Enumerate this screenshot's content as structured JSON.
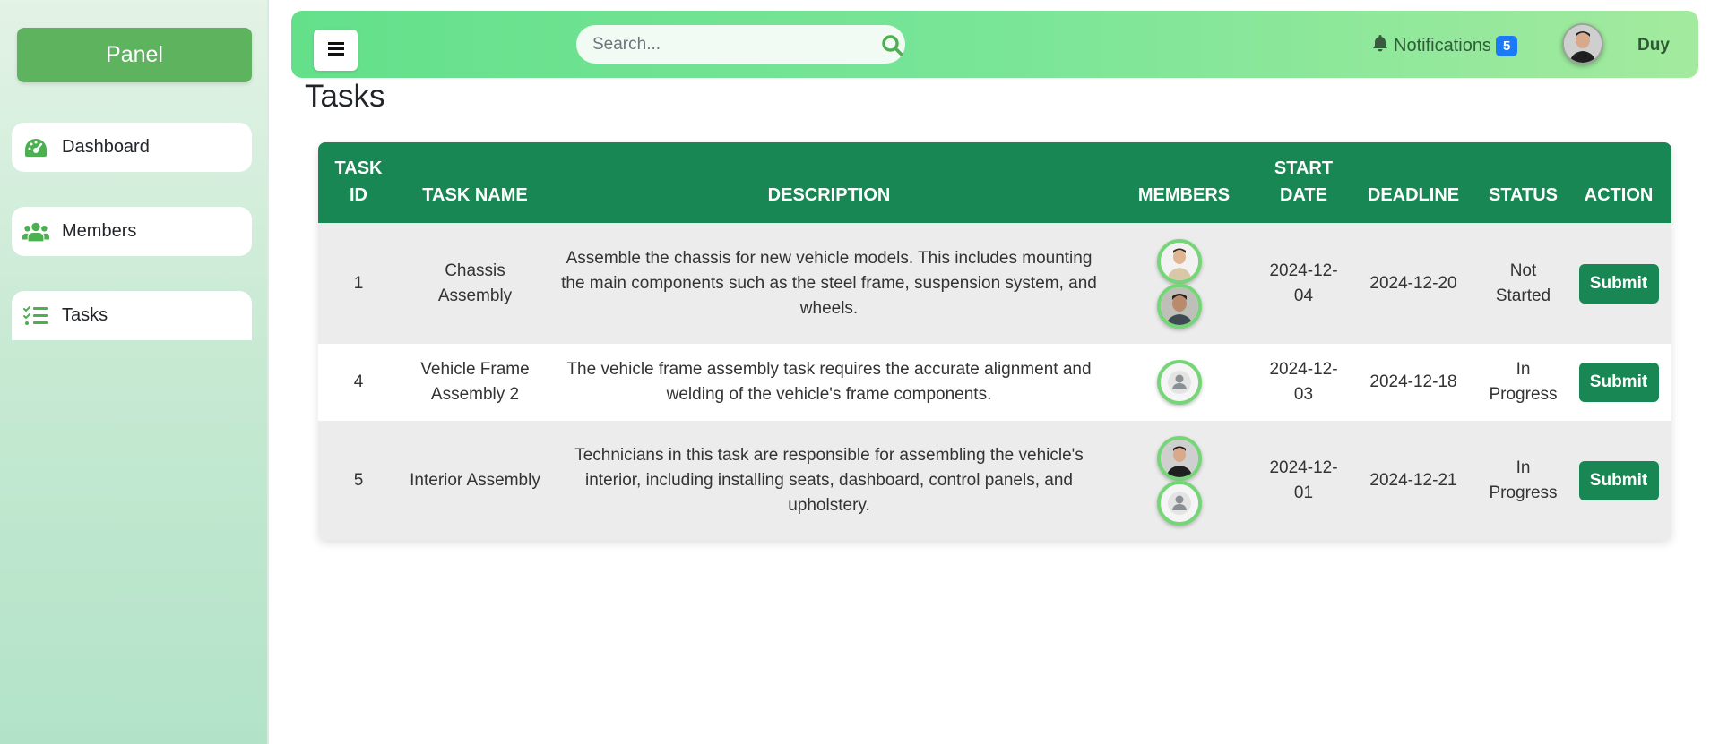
{
  "sidebar": {
    "panel_label": "Panel",
    "items": [
      {
        "label": "Dashboard",
        "icon": "gauge-icon"
      },
      {
        "label": "Members",
        "icon": "users-icon"
      },
      {
        "label": "Tasks",
        "icon": "list-check-icon"
      }
    ]
  },
  "header": {
    "search_placeholder": "Search...",
    "notifications_label": "Notifications",
    "notifications_count": "5",
    "username": "Duy"
  },
  "page": {
    "title": "Tasks"
  },
  "table": {
    "headers": {
      "task_id": "Task ID",
      "task_name": "Task Name",
      "description": "Description",
      "members": "Members",
      "start_date": "Start Date",
      "deadline": "Deadline",
      "status": "Status",
      "action": "Action"
    },
    "rows": [
      {
        "id": "1",
        "name": "Chassis Assembly",
        "description": "Assemble the chassis for new vehicle models. This includes mounting the main components such as the steel frame, suspension system, and wheels.",
        "members": [
          "photo-member-icon",
          "photo-member-icon"
        ],
        "start": "2024-12-04",
        "deadline": "2024-12-20",
        "status": "Not Started",
        "action": "Submit"
      },
      {
        "id": "4",
        "name": "Vehicle Frame Assembly 2",
        "description": "The vehicle frame assembly task requires the accurate alignment and welding of the vehicle's frame components.",
        "members": [
          "default-user-icon"
        ],
        "start": "2024-12-03",
        "deadline": "2024-12-18",
        "status": "In Progress",
        "action": "Submit"
      },
      {
        "id": "5",
        "name": "Interior Assembly",
        "description": "Technicians in this task are responsible for assembling the vehicle's interior, including installing seats, dashboard, control panels, and upholstery.",
        "members": [
          "photo-member-icon",
          "default-user-icon"
        ],
        "start": "2024-12-01",
        "deadline": "2024-12-21",
        "status": "In Progress",
        "action": "Submit"
      }
    ]
  },
  "colors": {
    "primary_green": "#198754",
    "panel_green": "#5eb35f",
    "badge_blue": "#1a7af8",
    "avatar_ring": "#74d676"
  }
}
